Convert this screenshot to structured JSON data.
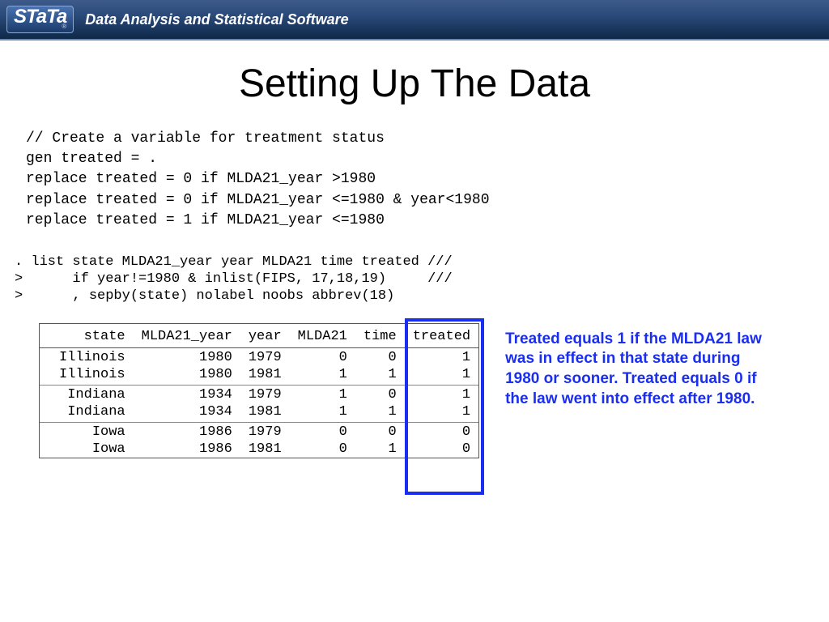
{
  "header": {
    "logo_text": "STaTa",
    "logo_reg": "®",
    "subtitle": "Data Analysis and Statistical Software"
  },
  "slide": {
    "title": "Setting Up The Data"
  },
  "code": {
    "line1": "// Create a variable for treatment status",
    "line2": "gen treated = .",
    "line3": "replace treated = 0 if MLDA21_year >1980",
    "line4": "replace treated = 0 if MLDA21_year <=1980 & year<1980",
    "line5": "replace treated = 1 if MLDA21_year <=1980"
  },
  "list_cmd": {
    "line1": ". list state MLDA21_year year MLDA21 time treated ///",
    "line2": ">      if year!=1980 & inlist(FIPS, 17,18,19)     ///",
    "line3": ">      , sepby(state) nolabel noobs abbrev(18)"
  },
  "table": {
    "headers": [
      "state",
      "MLDA21_year",
      "year",
      "MLDA21",
      "time",
      "treated"
    ],
    "groups": [
      [
        {
          "state": "Illinois",
          "mlda21_year": "1980",
          "year": "1979",
          "mlda21": "0",
          "time": "0",
          "treated": "1"
        },
        {
          "state": "Illinois",
          "mlda21_year": "1980",
          "year": "1981",
          "mlda21": "1",
          "time": "1",
          "treated": "1"
        }
      ],
      [
        {
          "state": "Indiana",
          "mlda21_year": "1934",
          "year": "1979",
          "mlda21": "1",
          "time": "0",
          "treated": "1"
        },
        {
          "state": "Indiana",
          "mlda21_year": "1934",
          "year": "1981",
          "mlda21": "1",
          "time": "1",
          "treated": "1"
        }
      ],
      [
        {
          "state": "Iowa",
          "mlda21_year": "1986",
          "year": "1979",
          "mlda21": "0",
          "time": "0",
          "treated": "0"
        },
        {
          "state": "Iowa",
          "mlda21_year": "1986",
          "year": "1981",
          "mlda21": "0",
          "time": "1",
          "treated": "0"
        }
      ]
    ]
  },
  "annotation": {
    "text": "Treated equals 1 if the MLDA21 law was in effect in that state during 1980 or sooner.   Treated equals 0 if the law went into effect after 1980."
  }
}
